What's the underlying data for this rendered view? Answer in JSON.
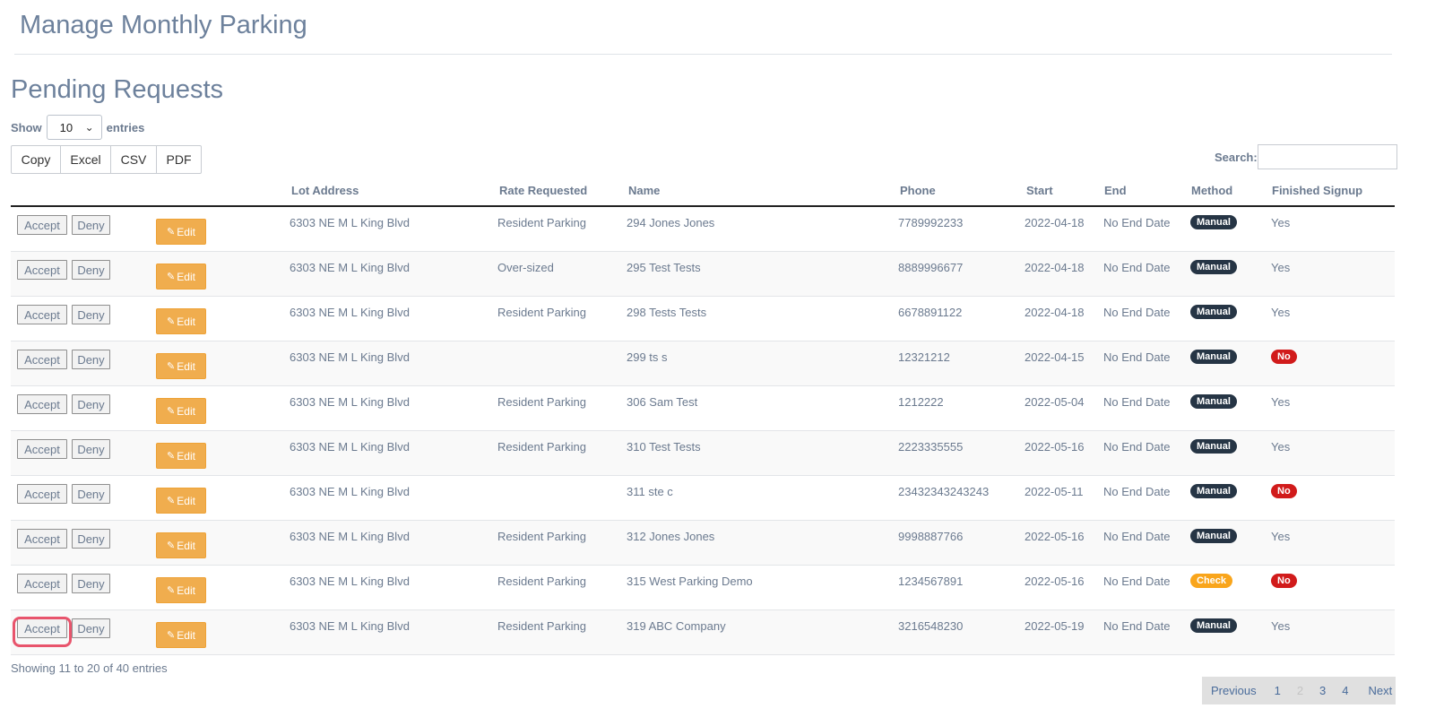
{
  "page": {
    "title": "Manage Monthly Parking"
  },
  "section": {
    "title": "Pending Requests"
  },
  "length": {
    "show_label": "Show",
    "value": "10",
    "entries_label": "entries"
  },
  "export": {
    "copy": "Copy",
    "excel": "Excel",
    "csv": "CSV",
    "pdf": "PDF"
  },
  "search": {
    "label": "Search:",
    "value": ""
  },
  "table": {
    "headers": {
      "lot_address": "Lot Address",
      "rate_requested": "Rate Requested",
      "name": "Name",
      "phone": "Phone",
      "start": "Start",
      "end": "End",
      "method": "Method",
      "finished_signup": "Finished Signup"
    },
    "actions": {
      "accept": "Accept",
      "deny": "Deny",
      "edit": "Edit"
    },
    "rows": [
      {
        "lot": "6303 NE M L King Blvd",
        "rate": "Resident Parking",
        "name": "294 Jones Jones",
        "phone": "7789992233",
        "start": "2022-04-18",
        "end": "No End Date",
        "method": "Manual",
        "finished": "Yes"
      },
      {
        "lot": "6303 NE M L King Blvd",
        "rate": "Over-sized",
        "name": "295 Test Tests",
        "phone": "8889996677",
        "start": "2022-04-18",
        "end": "No End Date",
        "method": "Manual",
        "finished": "Yes"
      },
      {
        "lot": "6303 NE M L King Blvd",
        "rate": "Resident Parking",
        "name": "298 Tests Tests",
        "phone": "6678891122",
        "start": "2022-04-18",
        "end": "No End Date",
        "method": "Manual",
        "finished": "Yes"
      },
      {
        "lot": "6303 NE M L King Blvd",
        "rate": "",
        "name": "299 ts s",
        "phone": "12321212",
        "start": "2022-04-15",
        "end": "No End Date",
        "method": "Manual",
        "finished": "No"
      },
      {
        "lot": "6303 NE M L King Blvd",
        "rate": "Resident Parking",
        "name": "306 Sam Test",
        "phone": "1212222",
        "start": "2022-05-04",
        "end": "No End Date",
        "method": "Manual",
        "finished": "Yes"
      },
      {
        "lot": "6303 NE M L King Blvd",
        "rate": "Resident Parking",
        "name": "310 Test Tests",
        "phone": "2223335555",
        "start": "2022-05-16",
        "end": "No End Date",
        "method": "Manual",
        "finished": "Yes"
      },
      {
        "lot": "6303 NE M L King Blvd",
        "rate": "",
        "name": "311 ste c",
        "phone": "23432343243243",
        "start": "2022-05-11",
        "end": "No End Date",
        "method": "Manual",
        "finished": "No"
      },
      {
        "lot": "6303 NE M L King Blvd",
        "rate": "Resident Parking",
        "name": "312 Jones Jones",
        "phone": "9998887766",
        "start": "2022-05-16",
        "end": "No End Date",
        "method": "Manual",
        "finished": "Yes"
      },
      {
        "lot": "6303 NE M L King Blvd",
        "rate": "Resident Parking",
        "name": "315 West Parking Demo",
        "phone": "1234567891",
        "start": "2022-05-16",
        "end": "No End Date",
        "method": "Check",
        "finished": "No"
      },
      {
        "lot": "6303 NE M L King Blvd",
        "rate": "Resident Parking",
        "name": "319 ABC Company",
        "phone": "3216548230",
        "start": "2022-05-19",
        "end": "No End Date",
        "method": "Manual",
        "finished": "Yes"
      }
    ]
  },
  "info": {
    "text": "Showing 11 to 20 of 40 entries"
  },
  "pagination": {
    "previous": "Previous",
    "pages": [
      "1",
      "2",
      "3",
      "4"
    ],
    "current": "2",
    "next": "Next"
  },
  "colors": {
    "manual_badge": "#263545",
    "check_badge": "#f9a51b",
    "no_badge": "#d11b1b",
    "edit_button": "#f0ad4e",
    "title": "#6d819c",
    "link": "#4a6c9b"
  }
}
